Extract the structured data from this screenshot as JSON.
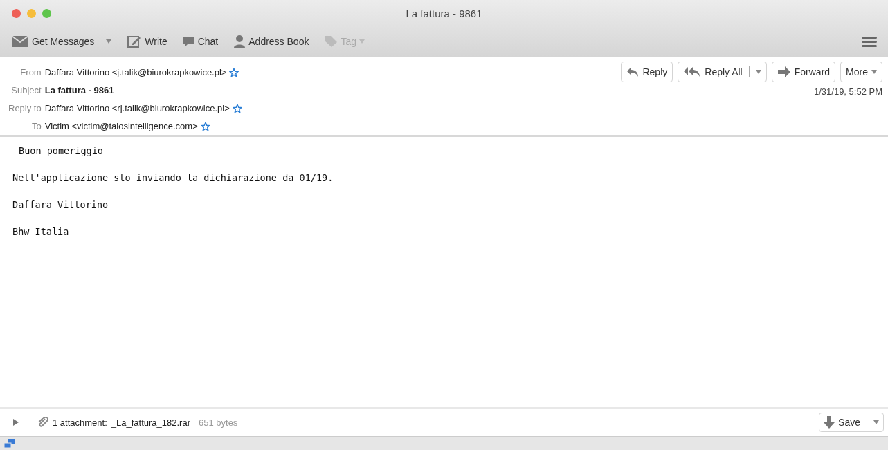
{
  "window": {
    "title": "La fattura - 9861"
  },
  "toolbar": [
    {
      "label": "Get Messages",
      "kind": "mail",
      "dropdown": true,
      "disabled": false
    },
    {
      "label": "Write",
      "kind": "write",
      "dropdown": false,
      "disabled": false
    },
    {
      "label": "Chat",
      "kind": "chat",
      "dropdown": false,
      "disabled": false
    },
    {
      "label": "Address Book",
      "kind": "person",
      "dropdown": false,
      "disabled": false
    },
    {
      "label": "Tag",
      "kind": "tag",
      "dropdown": true,
      "disabled": true
    }
  ],
  "header": {
    "fields": [
      {
        "label": "From",
        "value": "Daffara Vittorino <j.talik@biurokrapkowice.pl>",
        "kind": "address"
      },
      {
        "label": "Subject",
        "value": "La fattura - 9861",
        "kind": "subject"
      },
      {
        "label": "Reply to",
        "value": "Daffara Vittorino <rj.talik@biurokrapkowice.pl>",
        "kind": "address"
      },
      {
        "label": "To",
        "value": "Victim <victim@talosintelligence.com>",
        "kind": "address"
      }
    ],
    "actions": [
      {
        "label": "Reply",
        "kind": "reply"
      },
      {
        "label": "Reply All",
        "kind": "replyall"
      },
      {
        "label": "Forward",
        "kind": "forward"
      },
      {
        "label": "More",
        "kind": "menu"
      }
    ],
    "date": "1/31/19, 5:52 PM"
  },
  "body": [
    "Buon pomeriggio",
    "Nell'applicazione sto inviando la dichiarazione da 01/19.",
    "Daffara Vittorino",
    "Bhw Italia"
  ],
  "attachments": {
    "expanded": false,
    "summary": "1 attachment:",
    "name": "_La_fattura_182.rar",
    "size": "651 bytes",
    "save": "Save"
  }
}
